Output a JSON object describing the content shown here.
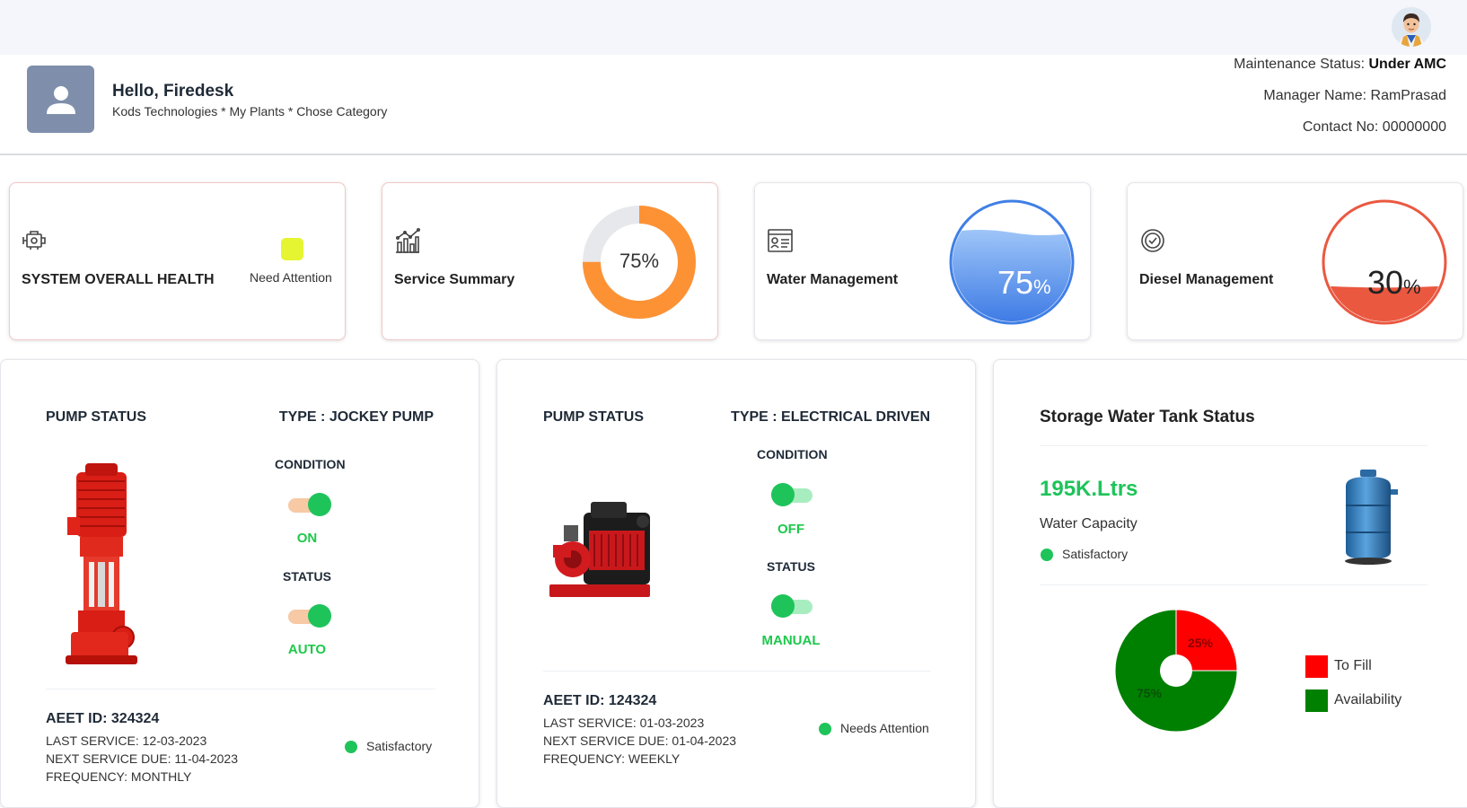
{
  "header": {
    "greeting": "Hello, Firedesk",
    "breadcrumb": "Kods Technologies * My Plants * Chose Category",
    "maintenance_label": "Maintenance Status: ",
    "maintenance_value": "Under AMC",
    "manager": "Manager Name: RamPrasad",
    "contact": "Contact No: 00000000"
  },
  "cards": {
    "health": {
      "title": "SYSTEM OVERALL HEALTH",
      "status": "Need Attention",
      "status_color": "#e6f531"
    },
    "service": {
      "title": "Service Summary",
      "percent_text": "75%",
      "percent": 75,
      "color": "#fd9235"
    },
    "water": {
      "title": "Water Management",
      "percent_num": "75",
      "percent_sign": "%",
      "level": 0.75,
      "color": "#3f7fe6"
    },
    "diesel": {
      "title": "Diesel Management",
      "percent_num": "30",
      "percent_sign": "%",
      "level": 0.3,
      "color": "#ea5840"
    }
  },
  "pump1": {
    "title": "PUMP STATUS",
    "type": "TYPE : JOCKEY PUMP",
    "condition_label": "CONDITION",
    "condition_value": "ON",
    "status_label": "STATUS",
    "status_value": "AUTO",
    "aeet": "AEET ID: 324324",
    "last_service": "LAST SERVICE: 12-03-2023",
    "next_service": "NEXT SERVICE DUE: 11-04-2023",
    "frequency": "FREQUENCY: MONTHLY",
    "health": "Satisfactory"
  },
  "pump2": {
    "title": "PUMP STATUS",
    "type": "TYPE : ELECTRICAL DRIVEN",
    "condition_label": "CONDITION",
    "condition_value": "OFF",
    "status_label": "STATUS",
    "status_value": "MANUAL",
    "aeet": "AEET ID: 124324",
    "last_service": "LAST SERVICE: 01-03-2023",
    "next_service": "NEXT SERVICE DUE: 01-04-2023",
    "frequency": "FREQUENCY: WEEKLY",
    "health": "Needs Attention"
  },
  "tank": {
    "title": "Storage Water Tank Status",
    "capacity": "195K.Ltrs",
    "capacity_label": "Water Capacity",
    "health": "Satisfactory",
    "legend_fill": "To Fill",
    "legend_avail": "Availability"
  },
  "chart_data": {
    "type": "pie",
    "categories": [
      "To Fill",
      "Availability"
    ],
    "values": [
      25,
      75
    ],
    "labels": [
      "25%",
      "75%"
    ],
    "colors": [
      "#ff0000",
      "#008000"
    ]
  }
}
